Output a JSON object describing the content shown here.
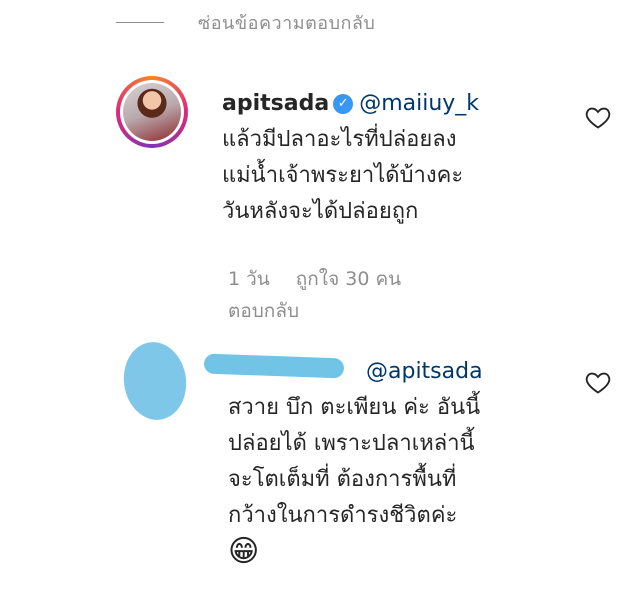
{
  "hide_replies": {
    "label": "ซ่อนข้อความตอบกลับ"
  },
  "comments": [
    {
      "username": "apitsada",
      "verified": true,
      "mention": "@maiiuy_k",
      "lines": [
        "แล้วมีปลาอะไรที่ปล่อยลง",
        "แม่น้ำเจ้าพระยาได้บ้างคะ",
        "วันหลังจะได้ปล่อยถูก"
      ],
      "time": "1 วัน",
      "likes": "ถูกใจ 30 คน",
      "reply_label": "ตอบกลับ"
    },
    {
      "username": "",
      "mention": "@apitsada",
      "lines": [
        "สวาย บึก ตะเพียน ค่ะ อันนี้",
        "ปล่อยได้ เพราะปลาเหล่านี้",
        "จะโตเต็มที่ ต้องการพื้นที่",
        "กว้างในการดำรงชีวิตค่ะ"
      ],
      "emoji": "😁"
    }
  ],
  "icons": {
    "heart": "heart-outline-icon",
    "verified": "verified-badge-icon"
  },
  "colors": {
    "muted": "#8e8e8e",
    "text": "#262626",
    "verified": "#3897f0",
    "redaction": "#72c4e6"
  }
}
